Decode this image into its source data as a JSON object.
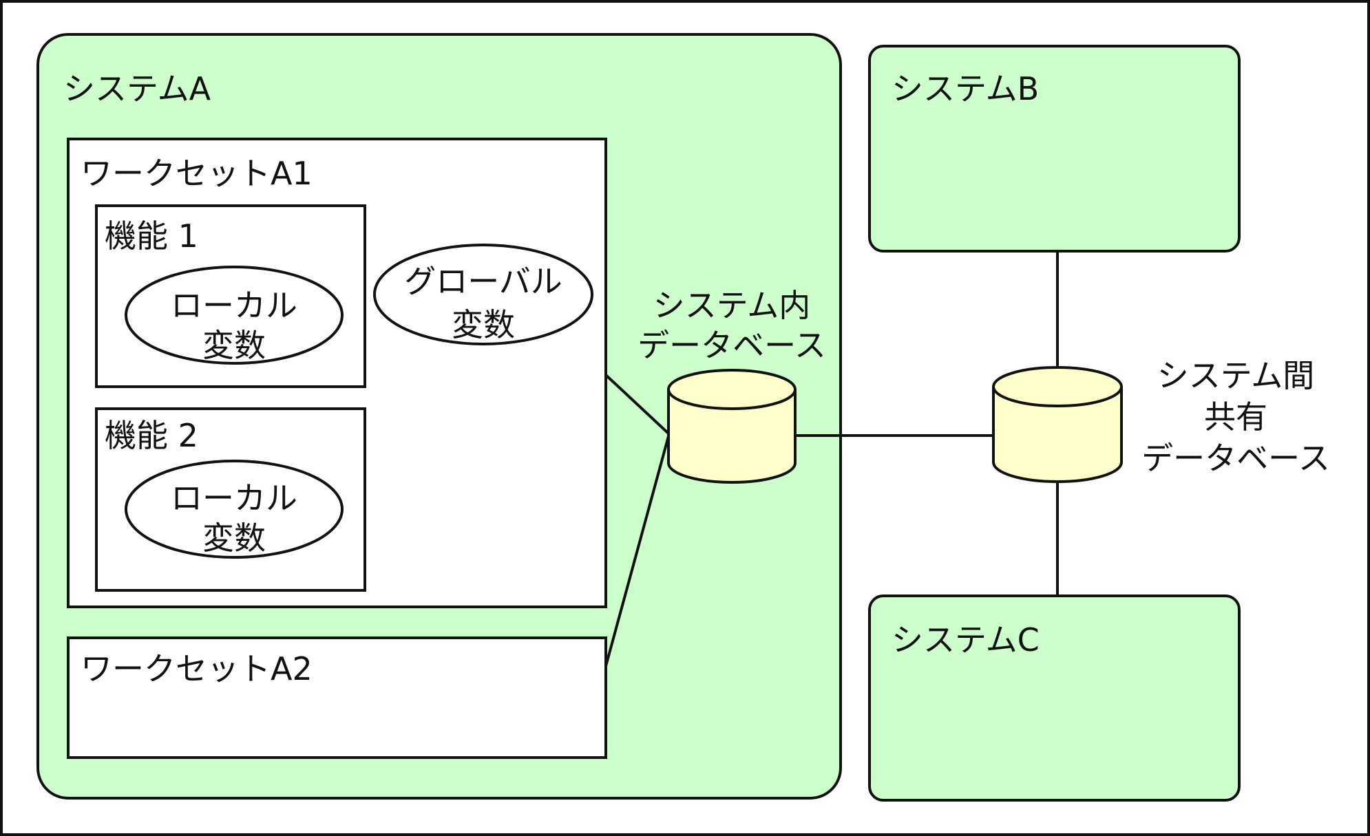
{
  "colors": {
    "system_fill": "#ccffcc",
    "database_fill": "#ffffcc",
    "box_fill": "#ffffff",
    "stroke": "#111111"
  },
  "systemA": {
    "label": "システムA",
    "workset_a1": {
      "label": "ワークセットA1",
      "function1": {
        "label": "機能 1",
        "local_var": [
          "ローカル",
          "変数"
        ]
      },
      "function2": {
        "label": "機能 2",
        "local_var": [
          "ローカル",
          "変数"
        ]
      },
      "global_var": [
        "グローバル",
        "変数"
      ]
    },
    "workset_a2": {
      "label": "ワークセットA2"
    },
    "internal_db": {
      "label": [
        "システム内",
        "データベース"
      ]
    }
  },
  "systemB": {
    "label": "システムB"
  },
  "systemC": {
    "label": "システムC"
  },
  "shared_db": {
    "label": [
      "システム間",
      "共有",
      "データベース"
    ]
  }
}
